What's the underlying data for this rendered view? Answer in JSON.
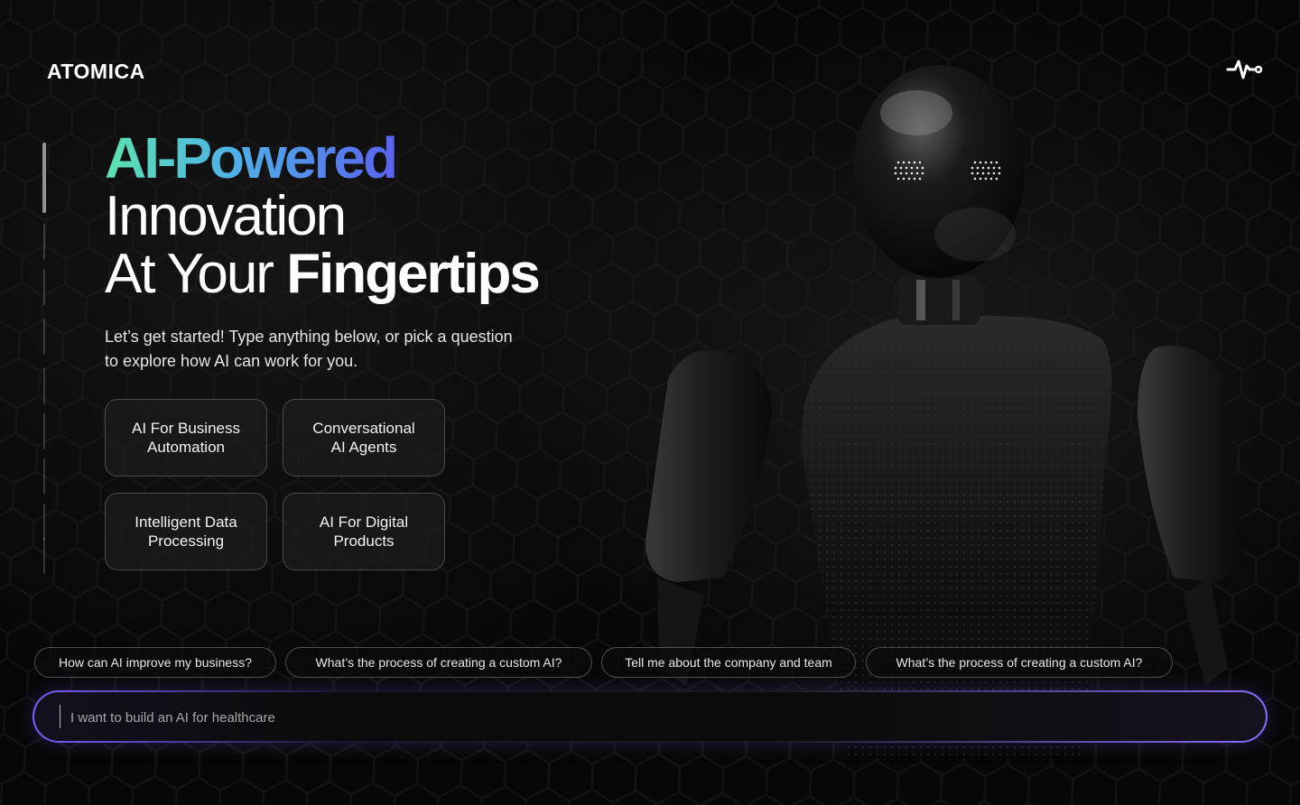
{
  "brand": {
    "name": "ATOMICA"
  },
  "header": {
    "activity_icon": "pulse-icon"
  },
  "hero": {
    "line1": "AI-Powered",
    "line2": "Innovation",
    "line3_regular": "At Your ",
    "line3_bold": "Fingertips"
  },
  "intro": {
    "line1": "Let’s get started! Type anything below, or pick a question",
    "line2": "to explore how AI can work for you."
  },
  "topics": [
    {
      "label": "AI For Business\nAutomation"
    },
    {
      "label": "Conversational\nAI Agents"
    },
    {
      "label": "Intelligent Data\nProcessing"
    },
    {
      "label": "AI For Digital\nProducts"
    }
  ],
  "suggestions": [
    {
      "label": "How can AI improve my business?"
    },
    {
      "label": "What’s the process of creating a custom AI?"
    },
    {
      "label": "Tell me about the company and team"
    },
    {
      "label": "What’s the process of creating a custom AI?"
    }
  ],
  "prompt": {
    "placeholder": "I want to build an AI for healthcare"
  },
  "colors": {
    "gradient_start": "#5de3b1",
    "gradient_mid": "#4fb0e8",
    "gradient_end": "#5a63f0",
    "prompt_glow": "#7c5cff"
  }
}
